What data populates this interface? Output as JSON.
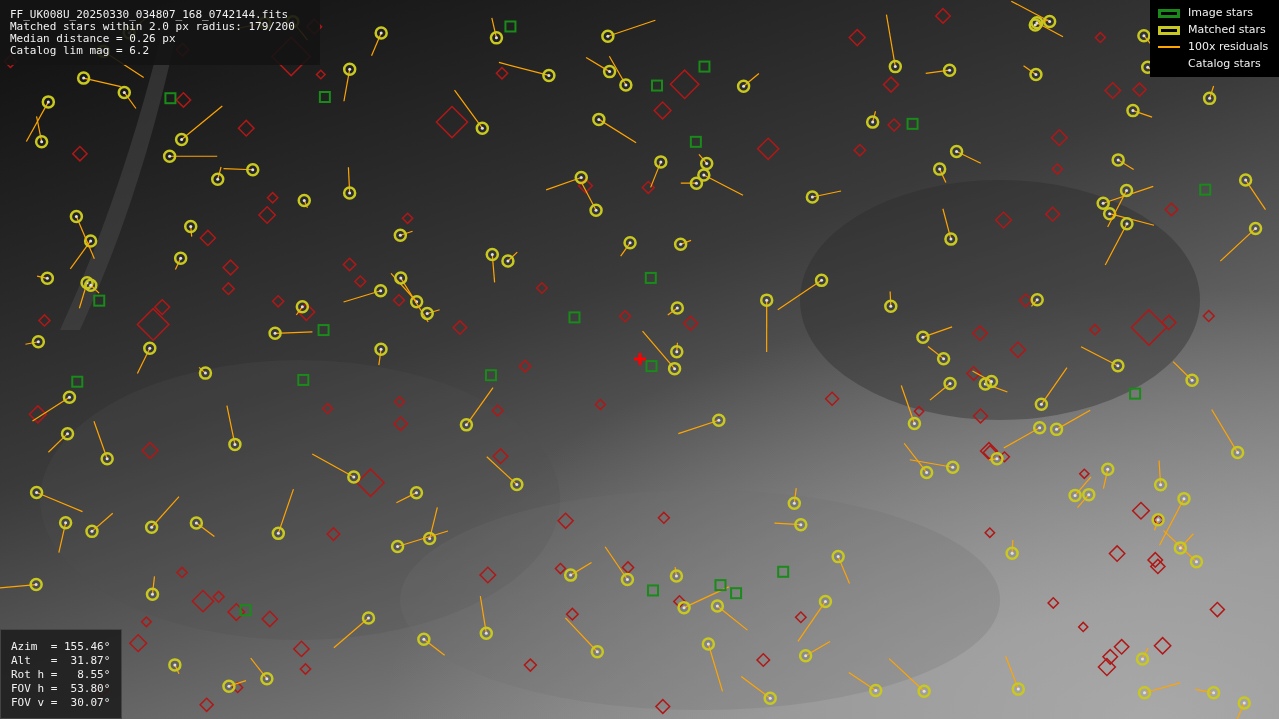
{
  "info": {
    "lines": [
      "FF_UK008U_20250330_034807_168_0742144.fits",
      "Matched stars within 2.0 px radius: 179/200",
      "Median distance = 0.26 px",
      "Catalog lim mag = 6.2"
    ]
  },
  "legend": {
    "items": [
      {
        "label": "Image stars",
        "kind": "box",
        "color": "#1a8a1a"
      },
      {
        "label": "Matched stars",
        "kind": "box",
        "color": "#c8c820"
      },
      {
        "label": "100x residuals",
        "kind": "line",
        "color": "#ffa500"
      },
      {
        "label": "Catalog stars",
        "kind": "none"
      }
    ]
  },
  "pointing": {
    "lines": [
      "Azim  = 155.46°",
      "Alt   =  31.87°",
      "Rot h =   8.55°",
      "FOV h =  53.80°",
      "FOV v =  30.07°"
    ]
  }
}
